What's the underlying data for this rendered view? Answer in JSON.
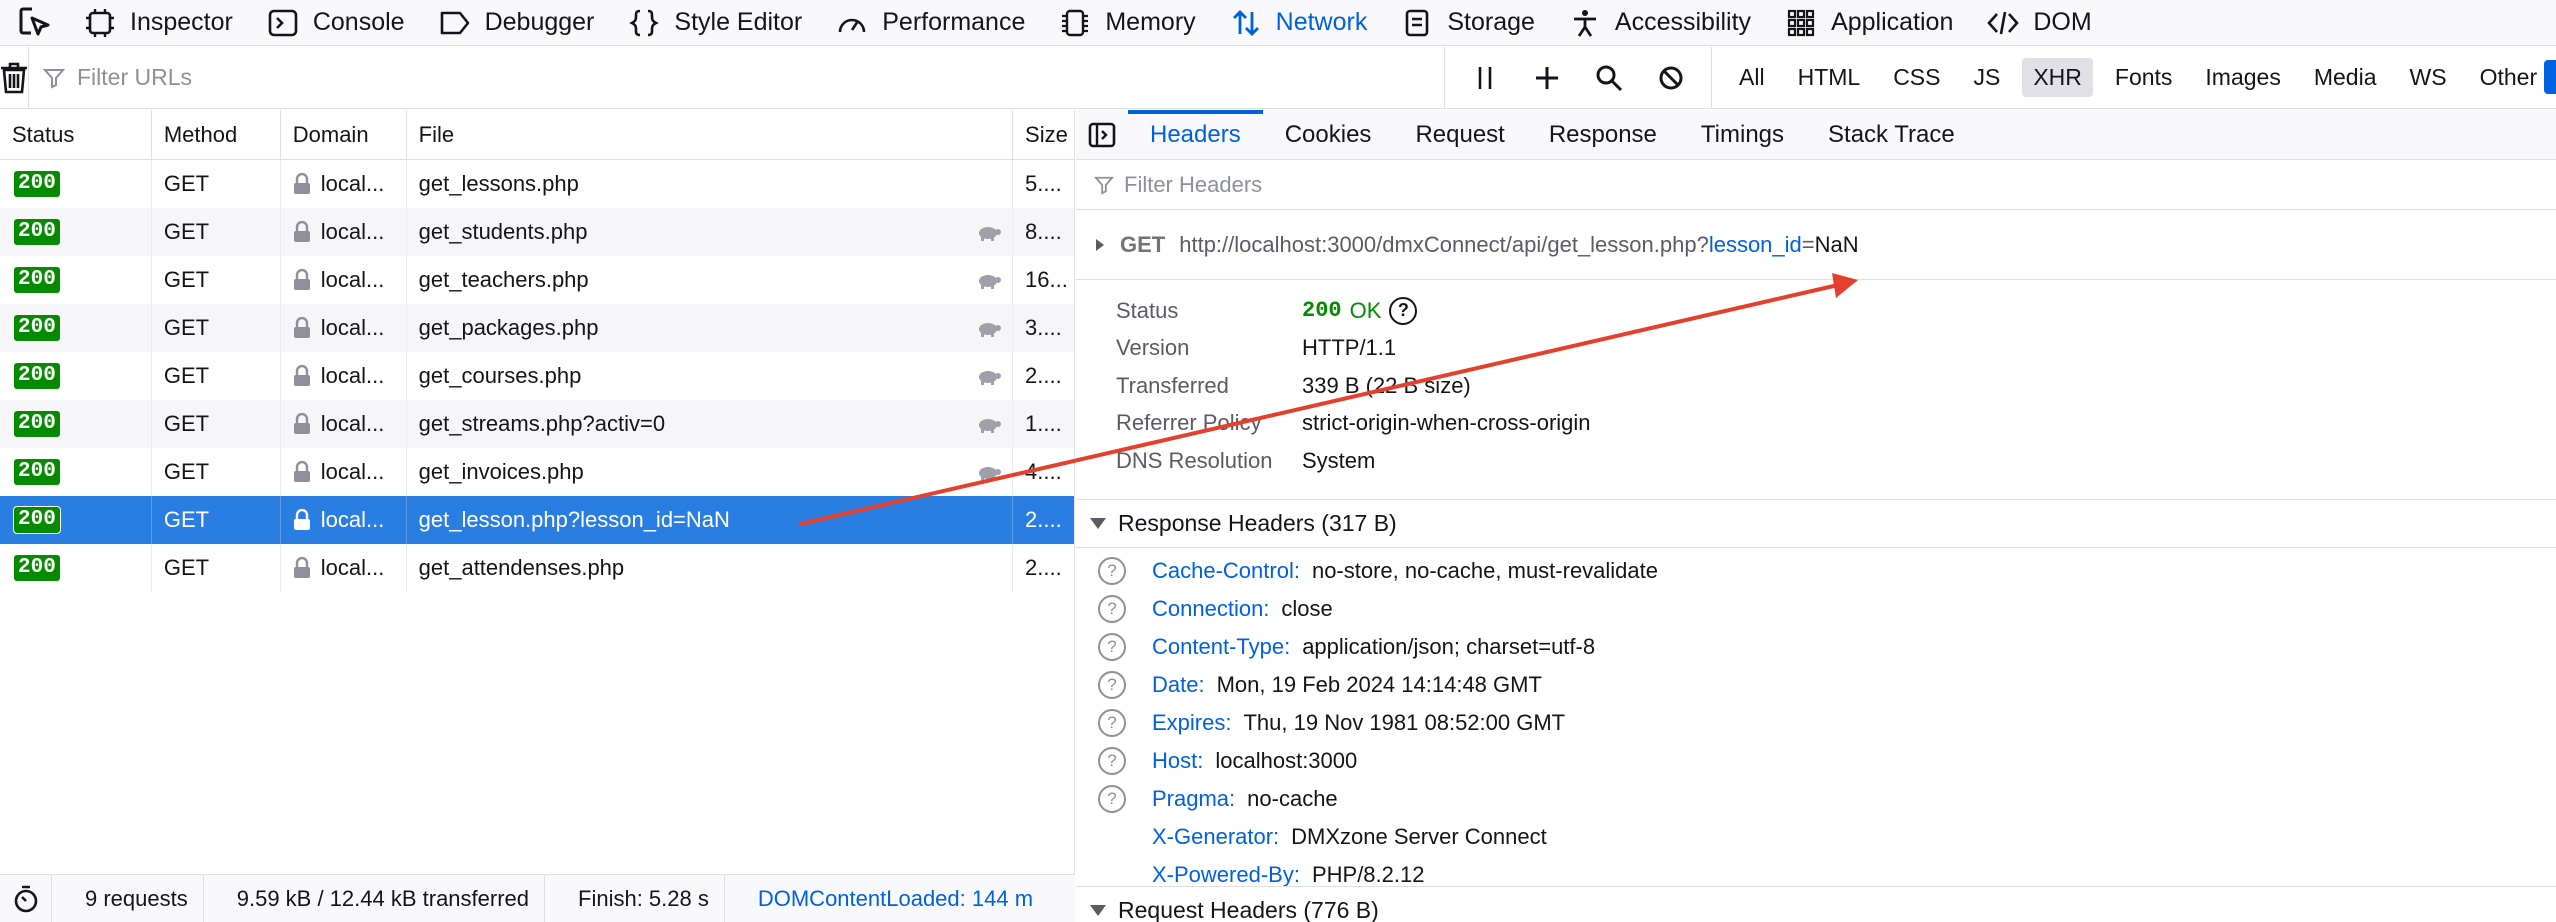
{
  "toolbar": {
    "tools": [
      {
        "label": "Inspector",
        "icon": "inspector-icon"
      },
      {
        "label": "Console",
        "icon": "console-icon"
      },
      {
        "label": "Debugger",
        "icon": "debugger-icon"
      },
      {
        "label": "Style Editor",
        "icon": "style-editor-icon"
      },
      {
        "label": "Performance",
        "icon": "performance-icon"
      },
      {
        "label": "Memory",
        "icon": "memory-icon"
      },
      {
        "label": "Network",
        "icon": "network-icon",
        "active": true
      },
      {
        "label": "Storage",
        "icon": "storage-icon"
      },
      {
        "label": "Accessibility",
        "icon": "accessibility-icon"
      },
      {
        "label": "Application",
        "icon": "application-icon"
      },
      {
        "label": "DOM",
        "icon": "dom-icon"
      }
    ]
  },
  "filter": {
    "placeholder": "Filter URLs",
    "types": [
      "All",
      "HTML",
      "CSS",
      "JS",
      "XHR",
      "Fonts",
      "Images",
      "Media",
      "WS",
      "Other"
    ],
    "active_type": "XHR"
  },
  "table": {
    "columns": {
      "status": "Status",
      "method": "Method",
      "domain": "Domain",
      "file": "File",
      "size": "Size"
    },
    "rows": [
      {
        "status": "200",
        "method": "GET",
        "domain": "local...",
        "file": "get_lessons.php",
        "size": "5....",
        "slow": false,
        "selected": false
      },
      {
        "status": "200",
        "method": "GET",
        "domain": "local...",
        "file": "get_students.php",
        "size": "8....",
        "slow": true,
        "selected": false
      },
      {
        "status": "200",
        "method": "GET",
        "domain": "local...",
        "file": "get_teachers.php",
        "size": "16...",
        "slow": true,
        "selected": false
      },
      {
        "status": "200",
        "method": "GET",
        "domain": "local...",
        "file": "get_packages.php",
        "size": "3....",
        "slow": true,
        "selected": false
      },
      {
        "status": "200",
        "method": "GET",
        "domain": "local...",
        "file": "get_courses.php",
        "size": "2....",
        "slow": true,
        "selected": false
      },
      {
        "status": "200",
        "method": "GET",
        "domain": "local...",
        "file": "get_streams.php?activ=0",
        "size": "1....",
        "slow": true,
        "selected": false
      },
      {
        "status": "200",
        "method": "GET",
        "domain": "local...",
        "file": "get_invoices.php",
        "size": "4....",
        "slow": true,
        "selected": false
      },
      {
        "status": "200",
        "method": "GET",
        "domain": "local...",
        "file": "get_lesson.php?lesson_id=NaN",
        "size": "2....",
        "slow": false,
        "selected": true
      },
      {
        "status": "200",
        "method": "GET",
        "domain": "local...",
        "file": "get_attendenses.php",
        "size": "2....",
        "slow": false,
        "selected": false
      }
    ]
  },
  "footer": {
    "requests": "9 requests",
    "transferred": "9.59 kB / 12.44 kB transferred",
    "finish": "Finish: 5.28 s",
    "dcl": "DOMContentLoaded: 144 m"
  },
  "details": {
    "tabs": [
      "Headers",
      "Cookies",
      "Request",
      "Response",
      "Timings",
      "Stack Trace"
    ],
    "active_tab": "Headers",
    "filter_placeholder": "Filter Headers",
    "url": {
      "method": "GET",
      "base": "http://localhost:3000/dmxConnect/api/get_lesson.php?",
      "query_key": "lesson_id",
      "eq": "=",
      "query_value": "NaN"
    },
    "summary": {
      "status_label": "Status",
      "status_code": "200",
      "status_text": "OK",
      "version_label": "Version",
      "version": "HTTP/1.1",
      "transferred_label": "Transferred",
      "transferred": "339 B (22 B size)",
      "referrer_label": "Referrer Policy",
      "referrer": "strict-origin-when-cross-origin",
      "dns_label": "DNS Resolution",
      "dns": "System"
    },
    "response_headers_title": "Response Headers (317 B)",
    "response_headers": [
      {
        "name": "Cache-Control:",
        "value": "no-store, no-cache, must-revalidate",
        "help": true
      },
      {
        "name": "Connection:",
        "value": "close",
        "help": true
      },
      {
        "name": "Content-Type:",
        "value": "application/json; charset=utf-8",
        "help": true
      },
      {
        "name": "Date:",
        "value": "Mon, 19 Feb 2024 14:14:48 GMT",
        "help": true
      },
      {
        "name": "Expires:",
        "value": "Thu, 19 Nov 1981 08:52:00 GMT",
        "help": true
      },
      {
        "name": "Host:",
        "value": "localhost:3000",
        "help": true
      },
      {
        "name": "Pragma:",
        "value": "no-cache",
        "help": true
      },
      {
        "name": "X-Generator:",
        "value": "DMXzone Server Connect",
        "help": false
      },
      {
        "name": "X-Powered-By:",
        "value": "PHP/8.2.12",
        "help": false
      }
    ],
    "request_headers_title": "Request Headers (776 B)"
  },
  "colors": {
    "accent": "#0061e0",
    "status_ok": "#058b00",
    "selected_row": "#2a7de1",
    "annotation_arrow": "#e5402d"
  }
}
